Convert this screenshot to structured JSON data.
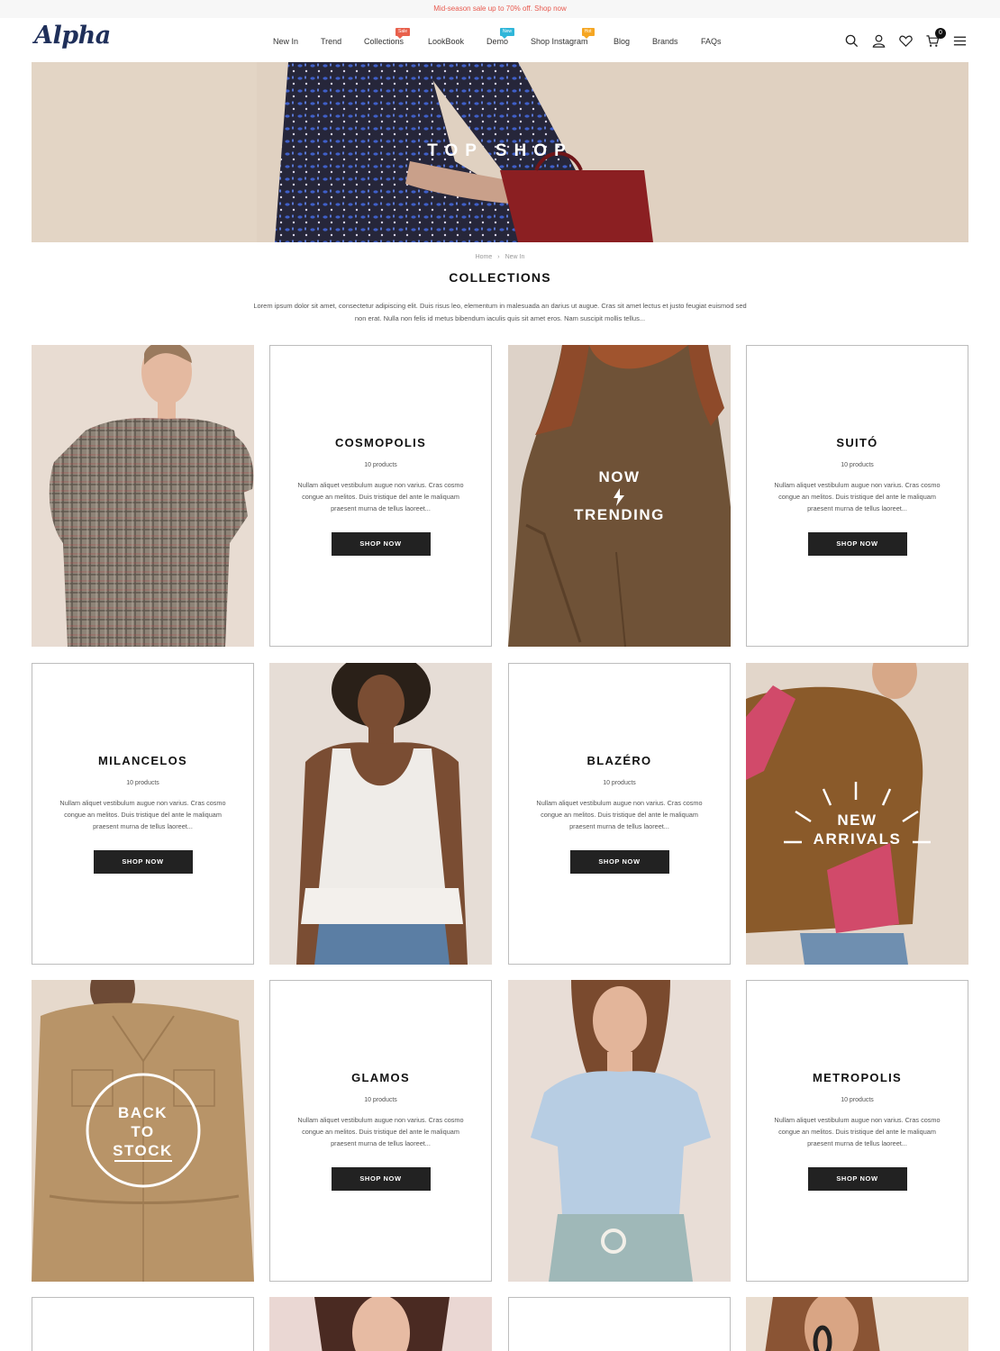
{
  "announcement": "Mid-season sale up to 70% off. Shop now",
  "brand": {
    "logo": "Alpha"
  },
  "nav": [
    {
      "label": "New In"
    },
    {
      "label": "Trend"
    },
    {
      "label": "Collections",
      "badge": "Sale",
      "badge_color": "#e8604c"
    },
    {
      "label": "LookBook"
    },
    {
      "label": "Demo",
      "badge": "New",
      "badge_color": "#2fb6d9"
    },
    {
      "label": "Shop Instagram",
      "badge": "Hot",
      "badge_color": "#f5a623"
    },
    {
      "label": "Blog"
    },
    {
      "label": "Brands"
    },
    {
      "label": "FAQs"
    }
  ],
  "icons": [
    "search-icon",
    "account-icon",
    "wishlist-icon",
    "cart-icon",
    "menu-icon"
  ],
  "cart_count": "0",
  "hero": {
    "title": "TOP SHOP"
  },
  "breadcrumb": {
    "home": "Home",
    "separator": "›",
    "current": "New In"
  },
  "page_title": "COLLECTIONS",
  "intro": "Lorem ipsum dolor sit amet, consectetur adipiscing elit. Duis risus leo, elementum in malesuada an darius ut augue. Cras sit amet lectus et justo feugiat euismod sed non erat. Nulla non felis id metus bibendum iaculis quis sit amet eros. Nam suscipit mollis tellus...",
  "collections": {
    "cosmopolis": {
      "name": "COSMOPOLIS",
      "count": "10 products",
      "desc": "Nullam aliquet vestibulum augue non varius. Cras cosmo congue an melitos. Duis tristique del ante le maliquam praesent murna de tellus laoreet...",
      "button": "SHOP NOW"
    },
    "suito": {
      "name": "SUITÓ",
      "count": "10 products",
      "desc": "Nullam aliquet vestibulum augue non varius. Cras cosmo congue an melitos. Duis tristique del ante le maliquam praesent murna de tellus laoreet...",
      "button": "SHOP NOW"
    },
    "milancelos": {
      "name": "MILANCELOS",
      "count": "10 products",
      "desc": "Nullam aliquet vestibulum augue non varius. Cras cosmo congue an melitos. Duis tristique del ante le maliquam praesent murna de tellus laoreet...",
      "button": "SHOP NOW"
    },
    "blazero": {
      "name": "BLAZÉRO",
      "count": "10 products",
      "desc": "Nullam aliquet vestibulum augue non varius. Cras cosmo congue an melitos. Duis tristique del ante le maliquam praesent murna de tellus laoreet...",
      "button": "SHOP NOW"
    },
    "glamos": {
      "name": "GLAMOS",
      "count": "10 products",
      "desc": "Nullam aliquet vestibulum augue non varius. Cras cosmo congue an melitos. Duis tristique del ante le maliquam praesent murna de tellus laoreet...",
      "button": "SHOP NOW"
    },
    "metropolis": {
      "name": "METROPOLIS",
      "count": "10 products",
      "desc": "Nullam aliquet vestibulum augue non varius. Cras cosmo congue an melitos. Duis tristique del ante le maliquam praesent murna de tellus laoreet...",
      "button": "SHOP NOW"
    }
  },
  "promos": {
    "trending": {
      "line1": "NOW",
      "line2": "TRENDING"
    },
    "arrivals": {
      "line1": "NEW",
      "line2": "ARRIVALS"
    },
    "stock": {
      "line1": "BACK",
      "line2": "TO",
      "line3": "STOCK"
    }
  }
}
